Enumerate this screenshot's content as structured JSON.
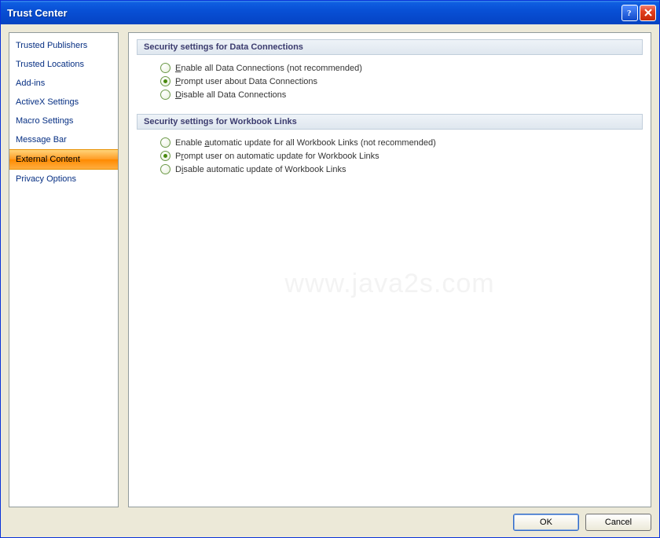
{
  "window": {
    "title": "Trust Center"
  },
  "sidebar": {
    "items": [
      {
        "label": "Trusted Publishers",
        "selected": false
      },
      {
        "label": "Trusted Locations",
        "selected": false
      },
      {
        "label": "Add-ins",
        "selected": false
      },
      {
        "label": "ActiveX Settings",
        "selected": false
      },
      {
        "label": "Macro Settings",
        "selected": false
      },
      {
        "label": "Message Bar",
        "selected": false
      },
      {
        "label": "External Content",
        "selected": true
      },
      {
        "label": "Privacy Options",
        "selected": false
      }
    ]
  },
  "sections": {
    "dataConnections": {
      "header": "Security settings for Data Connections",
      "options": [
        {
          "pre": "",
          "ul": "E",
          "post": "nable all Data Connections (not recommended)",
          "checked": false
        },
        {
          "pre": "",
          "ul": "P",
          "post": "rompt user about Data Connections",
          "checked": true
        },
        {
          "pre": "",
          "ul": "D",
          "post": "isable all Data Connections",
          "checked": false
        }
      ]
    },
    "workbookLinks": {
      "header": "Security settings for Workbook Links",
      "options": [
        {
          "pre": "Enable ",
          "ul": "a",
          "post": "utomatic update for all Workbook Links (not recommended)",
          "checked": false
        },
        {
          "pre": "P",
          "ul": "r",
          "post": "ompt user on automatic update for Workbook Links",
          "checked": true
        },
        {
          "pre": "D",
          "ul": "i",
          "post": "sable automatic update of Workbook Links",
          "checked": false
        }
      ]
    }
  },
  "buttons": {
    "ok": "OK",
    "cancel": "Cancel"
  },
  "watermark": "www.java2s.com"
}
